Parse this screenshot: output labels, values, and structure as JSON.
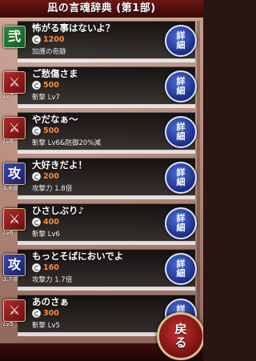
{
  "header": {
    "title": "凪の言魂辞典 (第1部)"
  },
  "items": [
    {
      "name": "怖がる事はないよ？",
      "cost": "1200",
      "effect": "加護の奇跡",
      "emblem": "弐",
      "level": "",
      "color": "green",
      "icon": "pentagram-icon"
    },
    {
      "name": "ご愁傷さま",
      "cost": "500",
      "effect": "斬撃 Lv7",
      "emblem": "⚔",
      "level": "Lv7",
      "color": "red",
      "icon": "crossed-swords-icon"
    },
    {
      "name": "やだなぁ～",
      "cost": "500",
      "effect": "斬撃 Lv6&防御20%減",
      "emblem": "⚔",
      "level": "Lv6",
      "color": "red",
      "icon": "crossed-swords-icon"
    },
    {
      "name": "大好きだよ！",
      "cost": "200",
      "effect": "攻撃力 1.8倍",
      "emblem": "攻",
      "level": "1.8倍",
      "color": "blue",
      "icon": "attack-up-icon"
    },
    {
      "name": "ひさしぶり♪",
      "cost": "400",
      "effect": "斬撃 Lv6",
      "emblem": "⚔",
      "level": "Lv6",
      "color": "red",
      "icon": "crossed-swords-icon"
    },
    {
      "name": "もっとそばにおいでよ",
      "cost": "160",
      "effect": "攻撃力 1.7倍",
      "emblem": "攻",
      "level": "1.7倍",
      "color": "blue",
      "icon": "attack-up-icon"
    },
    {
      "name": "あのさぁ",
      "cost": "300",
      "effect": "斬撃 Lv5",
      "emblem": "⚔",
      "level": "Lv5",
      "color": "red",
      "icon": "crossed-swords-icon"
    }
  ],
  "detail_button_label": "詳細",
  "back_button_label": "戻る"
}
